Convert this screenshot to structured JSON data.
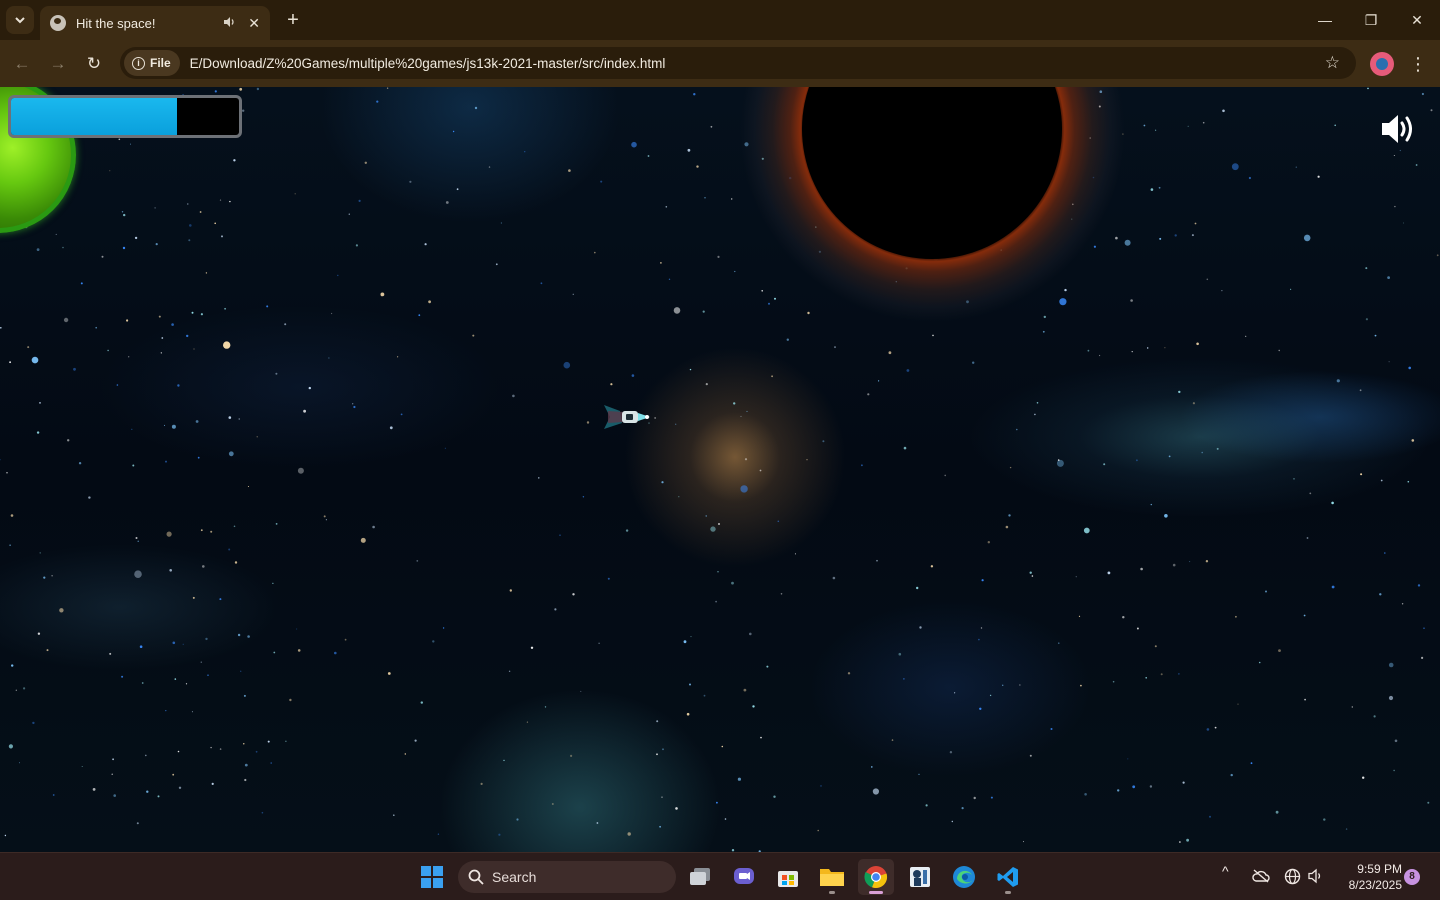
{
  "browser": {
    "tab": {
      "title": "Hit the space!",
      "audio_icon": "speaker-icon",
      "close_label": "✕"
    },
    "new_tab_label": "+",
    "window_controls": {
      "minimize": "—",
      "maximize": "❐",
      "close": "✕"
    },
    "nav": {
      "back": "←",
      "forward": "→",
      "reload": "↻"
    },
    "site_chip_label": "File",
    "address": "E/Download/Z%20Games/multiple%20games/js13k-2021-master/src/index.html",
    "bookmark_icon": "☆",
    "menu_icon": "⋮"
  },
  "game": {
    "energy_level_fraction": 0.73,
    "energy_color": "#0aa0dc",
    "planet_color": "#66c810",
    "blackhole_ring_color": "#8c2d0a",
    "sound_state": "on"
  },
  "taskbar": {
    "search_label": "Search",
    "apps": [
      "windows-start-icon",
      "task-view-icon",
      "chat-icon",
      "store-icon",
      "file-explorer-icon",
      "chrome-icon",
      "game-app-icon",
      "edge-icon",
      "vscode-icon"
    ],
    "tray": {
      "chevron": "^"
    },
    "time": "9:59 PM",
    "date": "8/23/2025",
    "notification_count": "8"
  }
}
